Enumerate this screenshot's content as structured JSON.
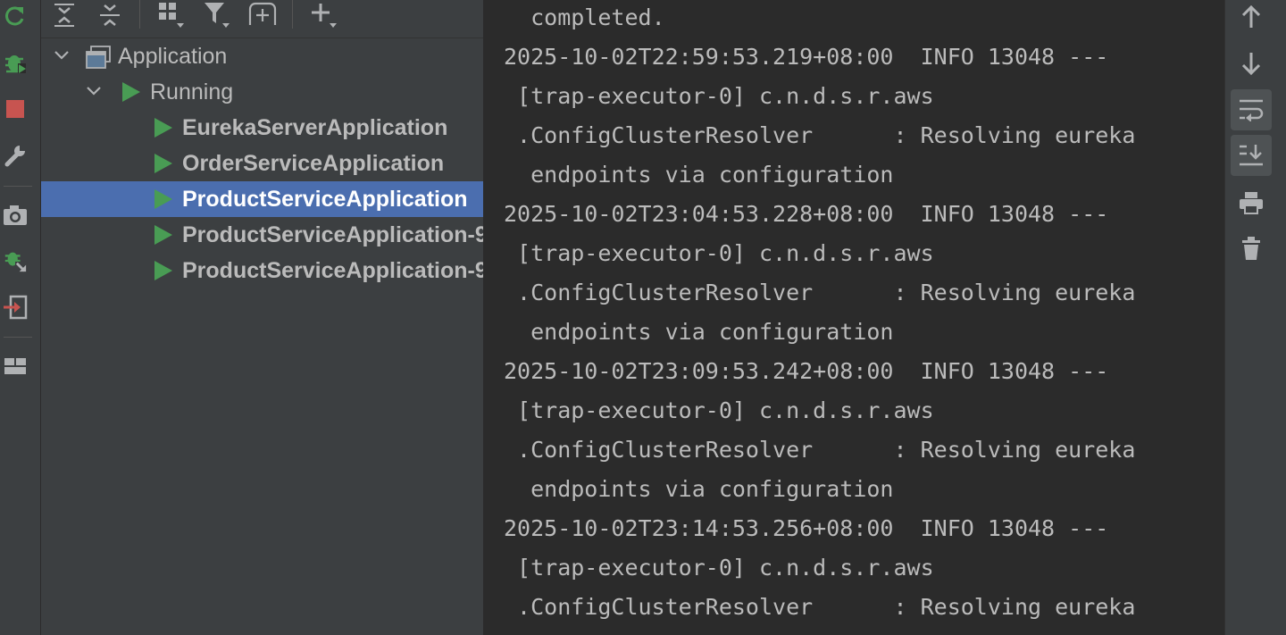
{
  "left_toolbar": {
    "icons": [
      "rerun-icon",
      "debug-icon",
      "stop-icon",
      "settings-wrench-icon",
      "screenshot-camera-icon",
      "attach-debugger-icon",
      "import-icon",
      "layout-icon"
    ],
    "colors": {
      "green": "#499c54",
      "red": "#c75450",
      "gray": "#afb1b3"
    }
  },
  "tree_toolbar": {
    "icons": [
      "expand-all-icon",
      "collapse-all-icon",
      "group-icon",
      "filter-icon",
      "new-run-config-icon",
      "add-icon"
    ]
  },
  "tree": {
    "root": {
      "label": "Application"
    },
    "group": {
      "label": "Running"
    },
    "items": [
      {
        "label": "EurekaServerApplication"
      },
      {
        "label": "OrderServiceApplication"
      },
      {
        "label": "ProductServiceApplication",
        "selected": true
      },
      {
        "label": "ProductServiceApplication-9"
      },
      {
        "label": "ProductServiceApplication-9"
      }
    ]
  },
  "console": {
    "lines": [
      "  completed.",
      "2025-10-02T22:59:53.219+08:00  INFO 13048 ---",
      " [trap-executor-0] c.n.d.s.r.aws",
      " .ConfigClusterResolver      : Resolving eureka",
      "  endpoints via configuration",
      "2025-10-02T23:04:53.228+08:00  INFO 13048 ---",
      " [trap-executor-0] c.n.d.s.r.aws",
      " .ConfigClusterResolver      : Resolving eureka",
      "  endpoints via configuration",
      "2025-10-02T23:09:53.242+08:00  INFO 13048 ---",
      " [trap-executor-0] c.n.d.s.r.aws",
      " .ConfigClusterResolver      : Resolving eureka",
      "  endpoints via configuration",
      "2025-10-02T23:14:53.256+08:00  INFO 13048 ---",
      " [trap-executor-0] c.n.d.s.r.aws",
      " .ConfigClusterResolver      : Resolving eureka"
    ]
  },
  "right_toolbar": {
    "icons": [
      "scroll-up-icon",
      "scroll-down-icon",
      "soft-wrap-icon",
      "scroll-to-end-icon",
      "print-icon",
      "clear-all-icon"
    ],
    "active": [
      "soft-wrap-icon",
      "scroll-to-end-icon"
    ]
  }
}
